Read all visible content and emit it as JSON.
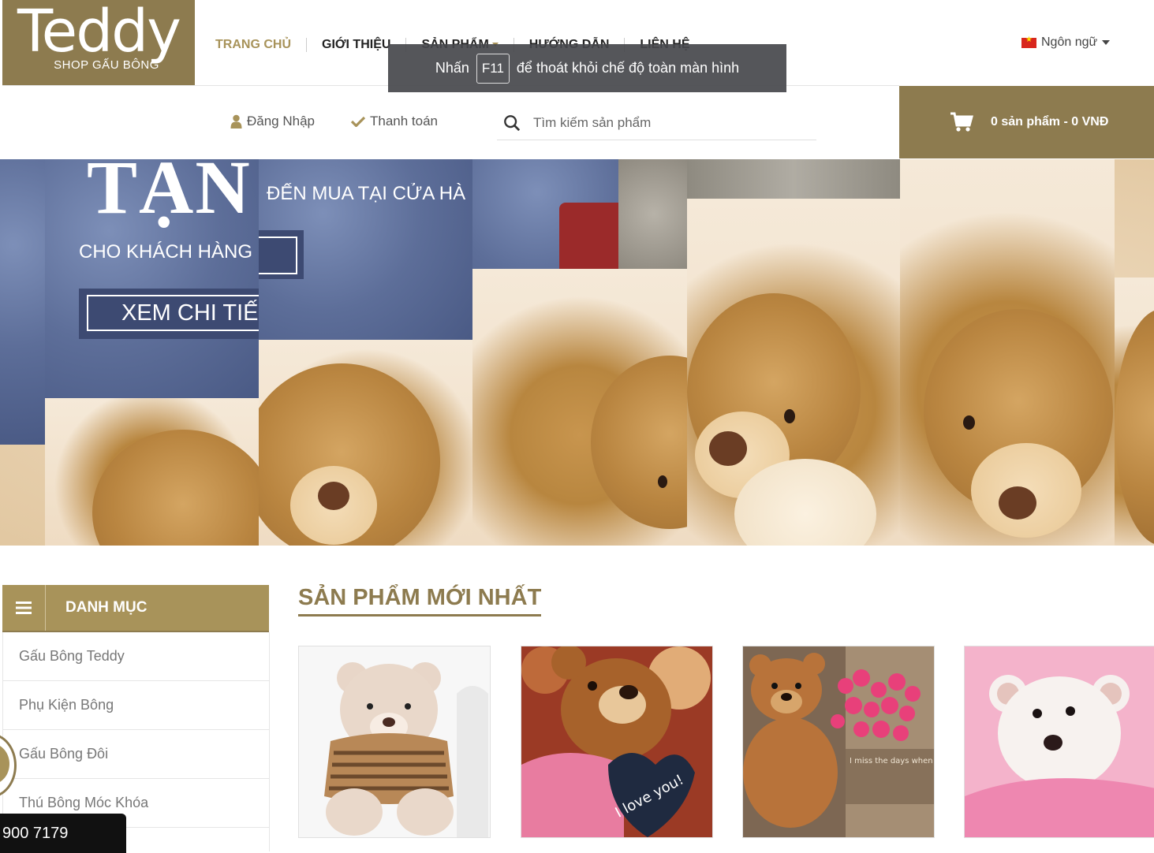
{
  "header": {
    "logo_text": "Teddy",
    "logo_sub": "SHOP GẤU BÔNG",
    "nav": [
      {
        "label": "TRANG CHỦ",
        "active": true
      },
      {
        "label": "GIỚI THIỆU",
        "active": false
      },
      {
        "label": "SẢN PHẨM",
        "active": false,
        "has_dropdown": true
      },
      {
        "label": "HƯỚNG DẪN",
        "active": false
      },
      {
        "label": "LIÊN HỆ",
        "active": false
      }
    ],
    "language_label": "Ngôn ngữ",
    "login_label": "Đăng Nhập",
    "checkout_label": "Thanh toán",
    "search_placeholder": "Tìm kiếm sản phẩm",
    "cart_label": "0 sản phẩm - 0 VNĐ",
    "accent_color": "#8d7b4f",
    "accent_light": "#a8935a"
  },
  "toast": {
    "prefix": "Nhấn",
    "key": "F11",
    "suffix": "để thoát khỏi chế độ toàn màn hình"
  },
  "banner": {
    "headline": "TẬN",
    "line1": "CHO KHÁCH HÀNG",
    "line2": "ĐẾN MUA TẠI CỬA HÀ",
    "button_label": "XEM CHI TIẾT"
  },
  "sidebar": {
    "title": "DANH MỤC",
    "items": [
      {
        "label": "Gấu Bông Teddy"
      },
      {
        "label": "Phụ Kiện Bông"
      },
      {
        "label": "Gấu Bông Đôi"
      },
      {
        "label": "Thú Bông Móc Khóa"
      }
    ],
    "phone": "900 7179"
  },
  "products": {
    "section_title": "SẢN PHẨM MỚI NHẤT",
    "items": [
      {
        "image": "teddy-striped-sweater"
      },
      {
        "image": "teddy-i-love-you-heart",
        "caption": "I love you!"
      },
      {
        "image": "teddy-with-roses",
        "caption": "I miss the days when all it took to make me feel better was a TEDDY BEAR."
      },
      {
        "image": "white-teddy-pink-blanket"
      }
    ]
  }
}
